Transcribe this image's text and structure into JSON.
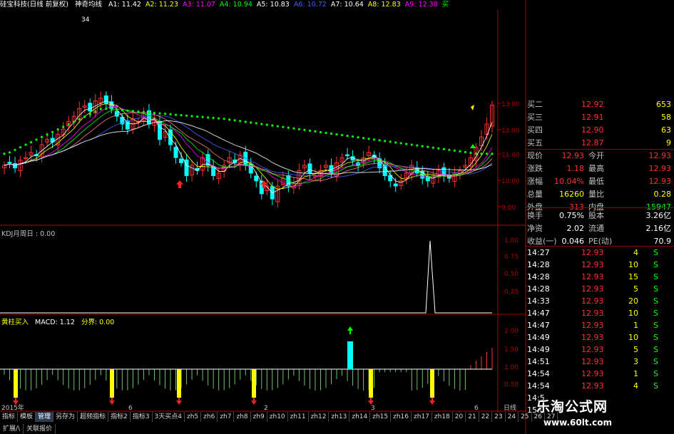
{
  "title_bar": {
    "stock": "硅宝科技(日线 前复权)",
    "indicator": "神奇均线",
    "ma": [
      {
        "label": "A1: 11.42",
        "color": "#ffffff"
      },
      {
        "label": "A2: 11.23",
        "color": "#ffff00"
      },
      {
        "label": "A3: 11.07",
        "color": "#ff00ff"
      },
      {
        "label": "A4: 10.94",
        "color": "#00ff00"
      },
      {
        "label": "A5: 10.83",
        "color": "#ffffff"
      },
      {
        "label": "A6: 10.72",
        "color": "#4060ff"
      },
      {
        "label": "A7: 10.64",
        "color": "#ffffff"
      },
      {
        "label": "A8: 12.83",
        "color": "#ffff00"
      },
      {
        "label": "A9: 12.38",
        "color": "#ff00ff"
      },
      {
        "label": "买",
        "color": "#00ff00"
      }
    ],
    "peak_label": "34"
  },
  "main_axis": {
    "labels": [
      "13.00",
      "12.00",
      "11.00",
      "10.00",
      "9.00"
    ]
  },
  "panel2": {
    "label": "KDJ月周日 : 0.00",
    "axis": [
      "1.00",
      "0.75",
      "0.50",
      "0.25"
    ]
  },
  "panel3": {
    "label_a": "黄柱买入",
    "label_b": "MACD: 1.12",
    "label_c": "分界: 0.00",
    "axis": [
      "2.00",
      "1.50",
      "1.00",
      "0.50"
    ]
  },
  "bottom_axis": {
    "year": "2015年",
    "ticks": [
      "6",
      "2",
      "3",
      "6"
    ],
    "suffix": "日线"
  },
  "quote": {
    "bids": [
      {
        "label": "买二",
        "price": "12.92",
        "vol": "653"
      },
      {
        "label": "买三",
        "price": "12.91",
        "vol": "58"
      },
      {
        "label": "买四",
        "price": "12.90",
        "vol": "63"
      },
      {
        "label": "买五",
        "price": "12.87",
        "vol": "9"
      }
    ],
    "stats": [
      {
        "l1": "现价",
        "v1": "12.93",
        "l2": "今开",
        "v2": "12.93",
        "c1": "#ff3030",
        "c2": "#ff3030"
      },
      {
        "l1": "涨跌",
        "v1": "1.18",
        "l2": "最高",
        "v2": "12.93",
        "c1": "#ff3030",
        "c2": "#ff3030"
      },
      {
        "l1": "涨幅",
        "v1": "10.04%",
        "l2": "最低",
        "v2": "12.93",
        "c1": "#ff3030",
        "c2": "#ff3030"
      },
      {
        "l1": "总量",
        "v1": "16260",
        "l2": "量比",
        "v2": "0.28",
        "c1": "#ffff00",
        "c2": "#ffff00"
      },
      {
        "l1": "外盘",
        "v1": "313",
        "l2": "内盘",
        "v2": "15947",
        "c1": "#ff3030",
        "c2": "#00ff00"
      }
    ],
    "stats2": [
      {
        "l1": "换手",
        "v1": "0.75%",
        "l2": "股本",
        "v2": "3.26亿"
      },
      {
        "l1": "净资",
        "v1": "2.02",
        "l2": "流通",
        "v2": "2.16亿"
      },
      {
        "l1": "收益(一)",
        "v1": "0.046",
        "l2": "PE(动)",
        "v2": "70.9"
      }
    ],
    "ticks": [
      {
        "t": "14:27",
        "p": "12.93",
        "v": "4",
        "s": "S"
      },
      {
        "t": "14:28",
        "p": "12.93",
        "v": "10",
        "s": "S"
      },
      {
        "t": "14:28",
        "p": "12.93",
        "v": "15",
        "s": "S"
      },
      {
        "t": "14:28",
        "p": "12.93",
        "v": "5",
        "s": "S"
      },
      {
        "t": "14:33",
        "p": "12.93",
        "v": "20",
        "s": "S"
      },
      {
        "t": "14:47",
        "p": "12.93",
        "v": "10",
        "s": "S"
      },
      {
        "t": "14:47",
        "p": "12.93",
        "v": "1",
        "s": "S"
      },
      {
        "t": "14:49",
        "p": "12.93",
        "v": "10",
        "s": "S"
      },
      {
        "t": "14:49",
        "p": "12.93",
        "v": "5",
        "s": "S"
      },
      {
        "t": "14:51",
        "p": "12.93",
        "v": "3",
        "s": "S"
      },
      {
        "t": "14:54",
        "p": "12.93",
        "v": "1",
        "s": "S"
      },
      {
        "t": "14:54",
        "p": "12.93",
        "v": "4",
        "s": "S"
      },
      {
        "t": "14:5",
        "p": "",
        "v": "",
        "s": ""
      },
      {
        "t": "15:0",
        "p": "",
        "v": "",
        "s": ""
      }
    ]
  },
  "tabs": [
    "指标",
    "模板",
    "管理",
    "另存为",
    "超频指标",
    "指标2",
    "指标3",
    "3天买点4",
    "zh5",
    "zh6",
    "zh7",
    "zh8",
    "zh9",
    "zh10",
    "zh11",
    "zh12",
    "zh13",
    "zh14",
    "zh15",
    "zh16",
    "zh17",
    "zh18",
    "20",
    "21",
    "22",
    "23",
    "24",
    "25",
    "26",
    "27"
  ],
  "active_tab": "管理",
  "tabs2": [
    "扩展/\\",
    "关联报价"
  ],
  "watermark": {
    "title": "乐淘公式网",
    "url": "www.60lt.com"
  },
  "colors": {
    "up": "#ff3030",
    "down": "#00ffff",
    "axis": "#b00000",
    "yellow": "#ffff00",
    "green": "#00ff00"
  }
}
